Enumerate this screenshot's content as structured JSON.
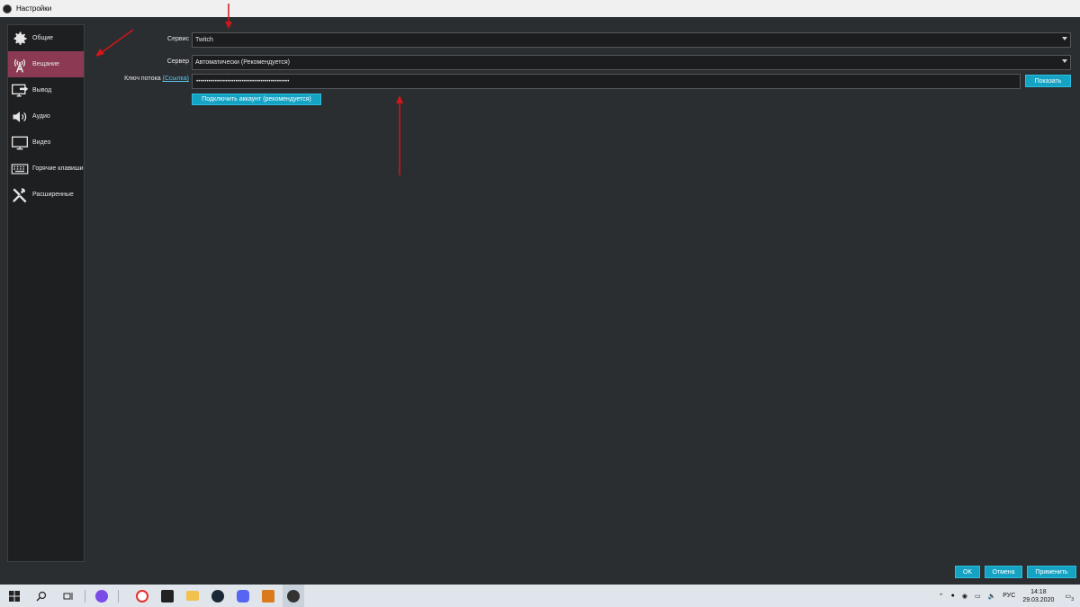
{
  "window": {
    "title": "Настройки"
  },
  "sidebar": {
    "items": [
      {
        "label": "Общие",
        "icon": "gear-icon",
        "active": false
      },
      {
        "label": "Вещание",
        "icon": "broadcast-icon",
        "active": true
      },
      {
        "label": "Вывод",
        "icon": "output-icon",
        "active": false
      },
      {
        "label": "Аудио",
        "icon": "speaker-icon",
        "active": false
      },
      {
        "label": "Видео",
        "icon": "monitor-icon",
        "active": false
      },
      {
        "label": "Горячие клавиши",
        "icon": "keyboard-icon",
        "active": false
      },
      {
        "label": "Расширенные",
        "icon": "tools-icon",
        "active": false
      }
    ]
  },
  "stream": {
    "service_label": "Сервис",
    "service_value": "Twitch",
    "server_label": "Сервер",
    "server_value": "Автоматически (Рекомендуется)",
    "key_label": "Ключ потока",
    "key_link": "(Ссылка)",
    "key_value": "•••••••••••••••••••••••••••••••••••••••••••••",
    "show_button": "Показать",
    "connect_button": "Подключить аккаунт (рекомендуется)"
  },
  "footer": {
    "ok": "OK",
    "cancel": "Отмена",
    "apply": "Применить"
  },
  "taskbar": {
    "lang": "РУС",
    "time": "14:18",
    "date": "29.03.2020",
    "notif_count": "3",
    "icons": [
      "windows-start-icon",
      "search-icon",
      "task-view-icon",
      "alice-icon",
      "yandex-browser-icon",
      "epic-games-icon",
      "file-explorer-icon",
      "steam-icon",
      "discord-icon",
      "csgo-icon",
      "obs-icon"
    ]
  },
  "colors": {
    "accent": "#15a3c4",
    "active_item": "#8c3a54",
    "annotation": "#d0161b"
  }
}
